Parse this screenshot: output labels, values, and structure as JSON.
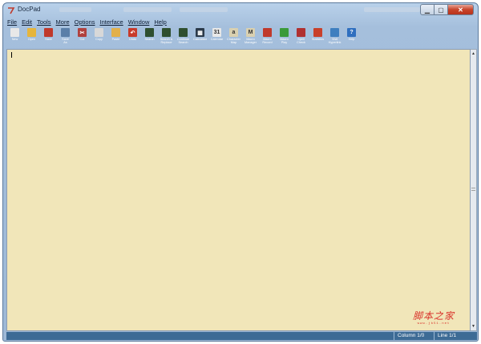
{
  "window": {
    "title": "DocPad"
  },
  "menu": [
    "File",
    "Edit",
    "Tools",
    "More",
    "Options",
    "Interface",
    "Window",
    "Help"
  ],
  "toolbar": [
    {
      "label": "New",
      "icon": "new-file-icon",
      "color": "#e8e8e8",
      "glyph": ""
    },
    {
      "label": "Open",
      "icon": "open-folder-icon",
      "color": "#e6b53c",
      "glyph": ""
    },
    {
      "label": "Save",
      "icon": "save-icon",
      "color": "#c0392b",
      "glyph": ""
    },
    {
      "label": "Save\nAs",
      "icon": "save-as-icon",
      "color": "#5b7fa8",
      "glyph": ""
    },
    {
      "label": "Cut",
      "icon": "scissors-icon",
      "color": "#b0413e",
      "glyph": "✂"
    },
    {
      "label": "Copy",
      "icon": "copy-icon",
      "color": "#d8d8d8",
      "glyph": ""
    },
    {
      "label": "Paste",
      "icon": "paste-icon",
      "color": "#e2b04a",
      "glyph": ""
    },
    {
      "label": "Undo",
      "icon": "undo-icon",
      "color": "#c83a2a",
      "glyph": "↶"
    },
    {
      "label": "Search",
      "icon": "binoculars-icon",
      "color": "#2f4f2f",
      "glyph": ""
    },
    {
      "label": "Search &\nReplace",
      "icon": "search-replace-icon",
      "color": "#2f4f2f",
      "glyph": ""
    },
    {
      "label": "Continue\nSearch",
      "icon": "continue-search-icon",
      "color": "#2f4f2f",
      "glyph": ""
    },
    {
      "label": "Calculator",
      "icon": "calculator-icon",
      "color": "#2b3a4a",
      "glyph": "▦"
    },
    {
      "label": "Calendar",
      "icon": "calendar-icon",
      "color": "#e8e8e8",
      "glyph": "31"
    },
    {
      "label": "Character\nMap",
      "icon": "character-map-icon",
      "color": "#d9d0b0",
      "glyph": "a"
    },
    {
      "label": "Macro\nManager",
      "icon": "macro-manager-icon",
      "color": "#d9d0b0",
      "glyph": "M"
    },
    {
      "label": "Macro\nRecord",
      "icon": "macro-record-icon",
      "color": "#c0392b",
      "glyph": ""
    },
    {
      "label": "Macro\nPlay",
      "icon": "macro-play-icon",
      "color": "#3a9a3a",
      "glyph": ""
    },
    {
      "label": "Spell\nCheck",
      "icon": "spell-check-icon",
      "color": "#b03030",
      "glyph": ""
    },
    {
      "label": "Statistics",
      "icon": "statistics-icon",
      "color": "#c8402a",
      "glyph": ""
    },
    {
      "label": "Visit\nHyperlink",
      "icon": "hyperlink-icon",
      "color": "#3f7fbf",
      "glyph": ""
    },
    {
      "label": "Help",
      "icon": "help-icon",
      "color": "#2f6fbf",
      "glyph": "?"
    }
  ],
  "status": {
    "column": "Column 1/0",
    "line": "Line 1/1"
  },
  "watermark": {
    "text": "脚本之家",
    "url": "www.jb51.net"
  }
}
